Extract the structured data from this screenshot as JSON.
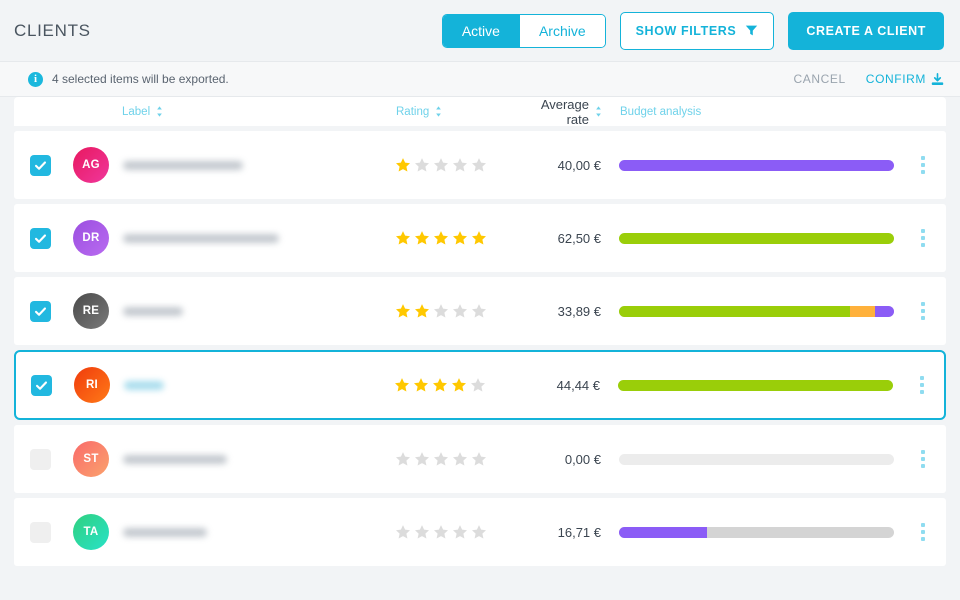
{
  "header": {
    "title": "CLIENTS",
    "segmented": {
      "options": [
        {
          "label": "Active",
          "active": true
        },
        {
          "label": "Archive",
          "active": false
        }
      ]
    },
    "show_filters_label": "SHOW FILTERS",
    "show_filters_icon": "filter-icon",
    "create_client_label": "CREATE A CLIENT"
  },
  "notice": {
    "icon": "info-icon",
    "text": "4 selected items will be exported.",
    "cancel_label": "CANCEL",
    "confirm_label": "CONFIRM",
    "confirm_icon": "export-icon"
  },
  "table": {
    "columns": [
      {
        "key": "label",
        "label": "Label",
        "sortable": true
      },
      {
        "key": "rating",
        "label": "Rating",
        "sortable": true
      },
      {
        "key": "average_rate",
        "label": "Average rate",
        "sortable": true
      },
      {
        "key": "budget_analysis",
        "label": "Budget analysis",
        "sortable": false
      }
    ],
    "rows": [
      {
        "checked": true,
        "selected": false,
        "initials": "AG",
        "avatar_from": "#e8185f",
        "avatar_to": "#f0379c",
        "label_redacted": true,
        "label_width": 120,
        "label_accent": false,
        "rating": 1,
        "average_rate": "40,00 €",
        "budget_segments": [
          {
            "color": "#8b5cf6",
            "percent": 100
          }
        ],
        "budget_empty": false,
        "menu_icon": "kebab-menu-icon"
      },
      {
        "checked": true,
        "selected": false,
        "initials": "DR",
        "avatar_from": "#9b4fe0",
        "avatar_to": "#b96bf0",
        "label_redacted": true,
        "label_width": 156,
        "label_accent": false,
        "rating": 5,
        "average_rate": "62,50 €",
        "budget_segments": [
          {
            "color": "#9ace09",
            "percent": 100
          }
        ],
        "budget_empty": false,
        "menu_icon": "kebab-menu-icon"
      },
      {
        "checked": true,
        "selected": false,
        "initials": "RE",
        "avatar_from": "#4a4a4a",
        "avatar_to": "#7a7a7a",
        "label_redacted": true,
        "label_width": 60,
        "label_accent": false,
        "rating": 2,
        "average_rate": "33,89 €",
        "budget_segments": [
          {
            "color": "#9ace09",
            "percent": 84
          },
          {
            "color": "#ffb13b",
            "percent": 9
          },
          {
            "color": "#8b5cf6",
            "percent": 7
          }
        ],
        "budget_empty": false,
        "menu_icon": "kebab-menu-icon"
      },
      {
        "checked": true,
        "selected": true,
        "initials": "RI",
        "avatar_from": "#f03b0c",
        "avatar_to": "#ff7a18",
        "label_redacted": true,
        "label_width": 40,
        "label_accent": true,
        "rating": 4,
        "average_rate": "44,44 €",
        "budget_segments": [
          {
            "color": "#9ace09",
            "percent": 100
          }
        ],
        "budget_empty": false,
        "menu_icon": "kebab-menu-icon"
      },
      {
        "checked": false,
        "selected": false,
        "initials": "ST",
        "avatar_from": "#f96a6a",
        "avatar_to": "#fba26d",
        "label_redacted": true,
        "label_width": 104,
        "label_accent": false,
        "rating": 0,
        "average_rate": "0,00 €",
        "budget_segments": [],
        "budget_empty": true,
        "menu_icon": "kebab-menu-icon"
      },
      {
        "checked": false,
        "selected": false,
        "initials": "TA",
        "avatar_from": "#2fd07f",
        "avatar_to": "#28e2c8",
        "label_redacted": true,
        "label_width": 84,
        "label_accent": false,
        "rating": 0,
        "average_rate": "16,71 €",
        "budget_segments": [
          {
            "color": "#8b5cf6",
            "percent": 32
          }
        ],
        "budget_empty": false,
        "menu_icon": "kebab-menu-icon"
      }
    ]
  },
  "colors": {
    "accent": "#14b3d9",
    "page_bg": "#f2f4f6",
    "star_on": "#ffc800",
    "star_off": "#dcdcdc",
    "green": "#9ace09",
    "purple": "#8b5cf6",
    "orange": "#ffb13b"
  }
}
